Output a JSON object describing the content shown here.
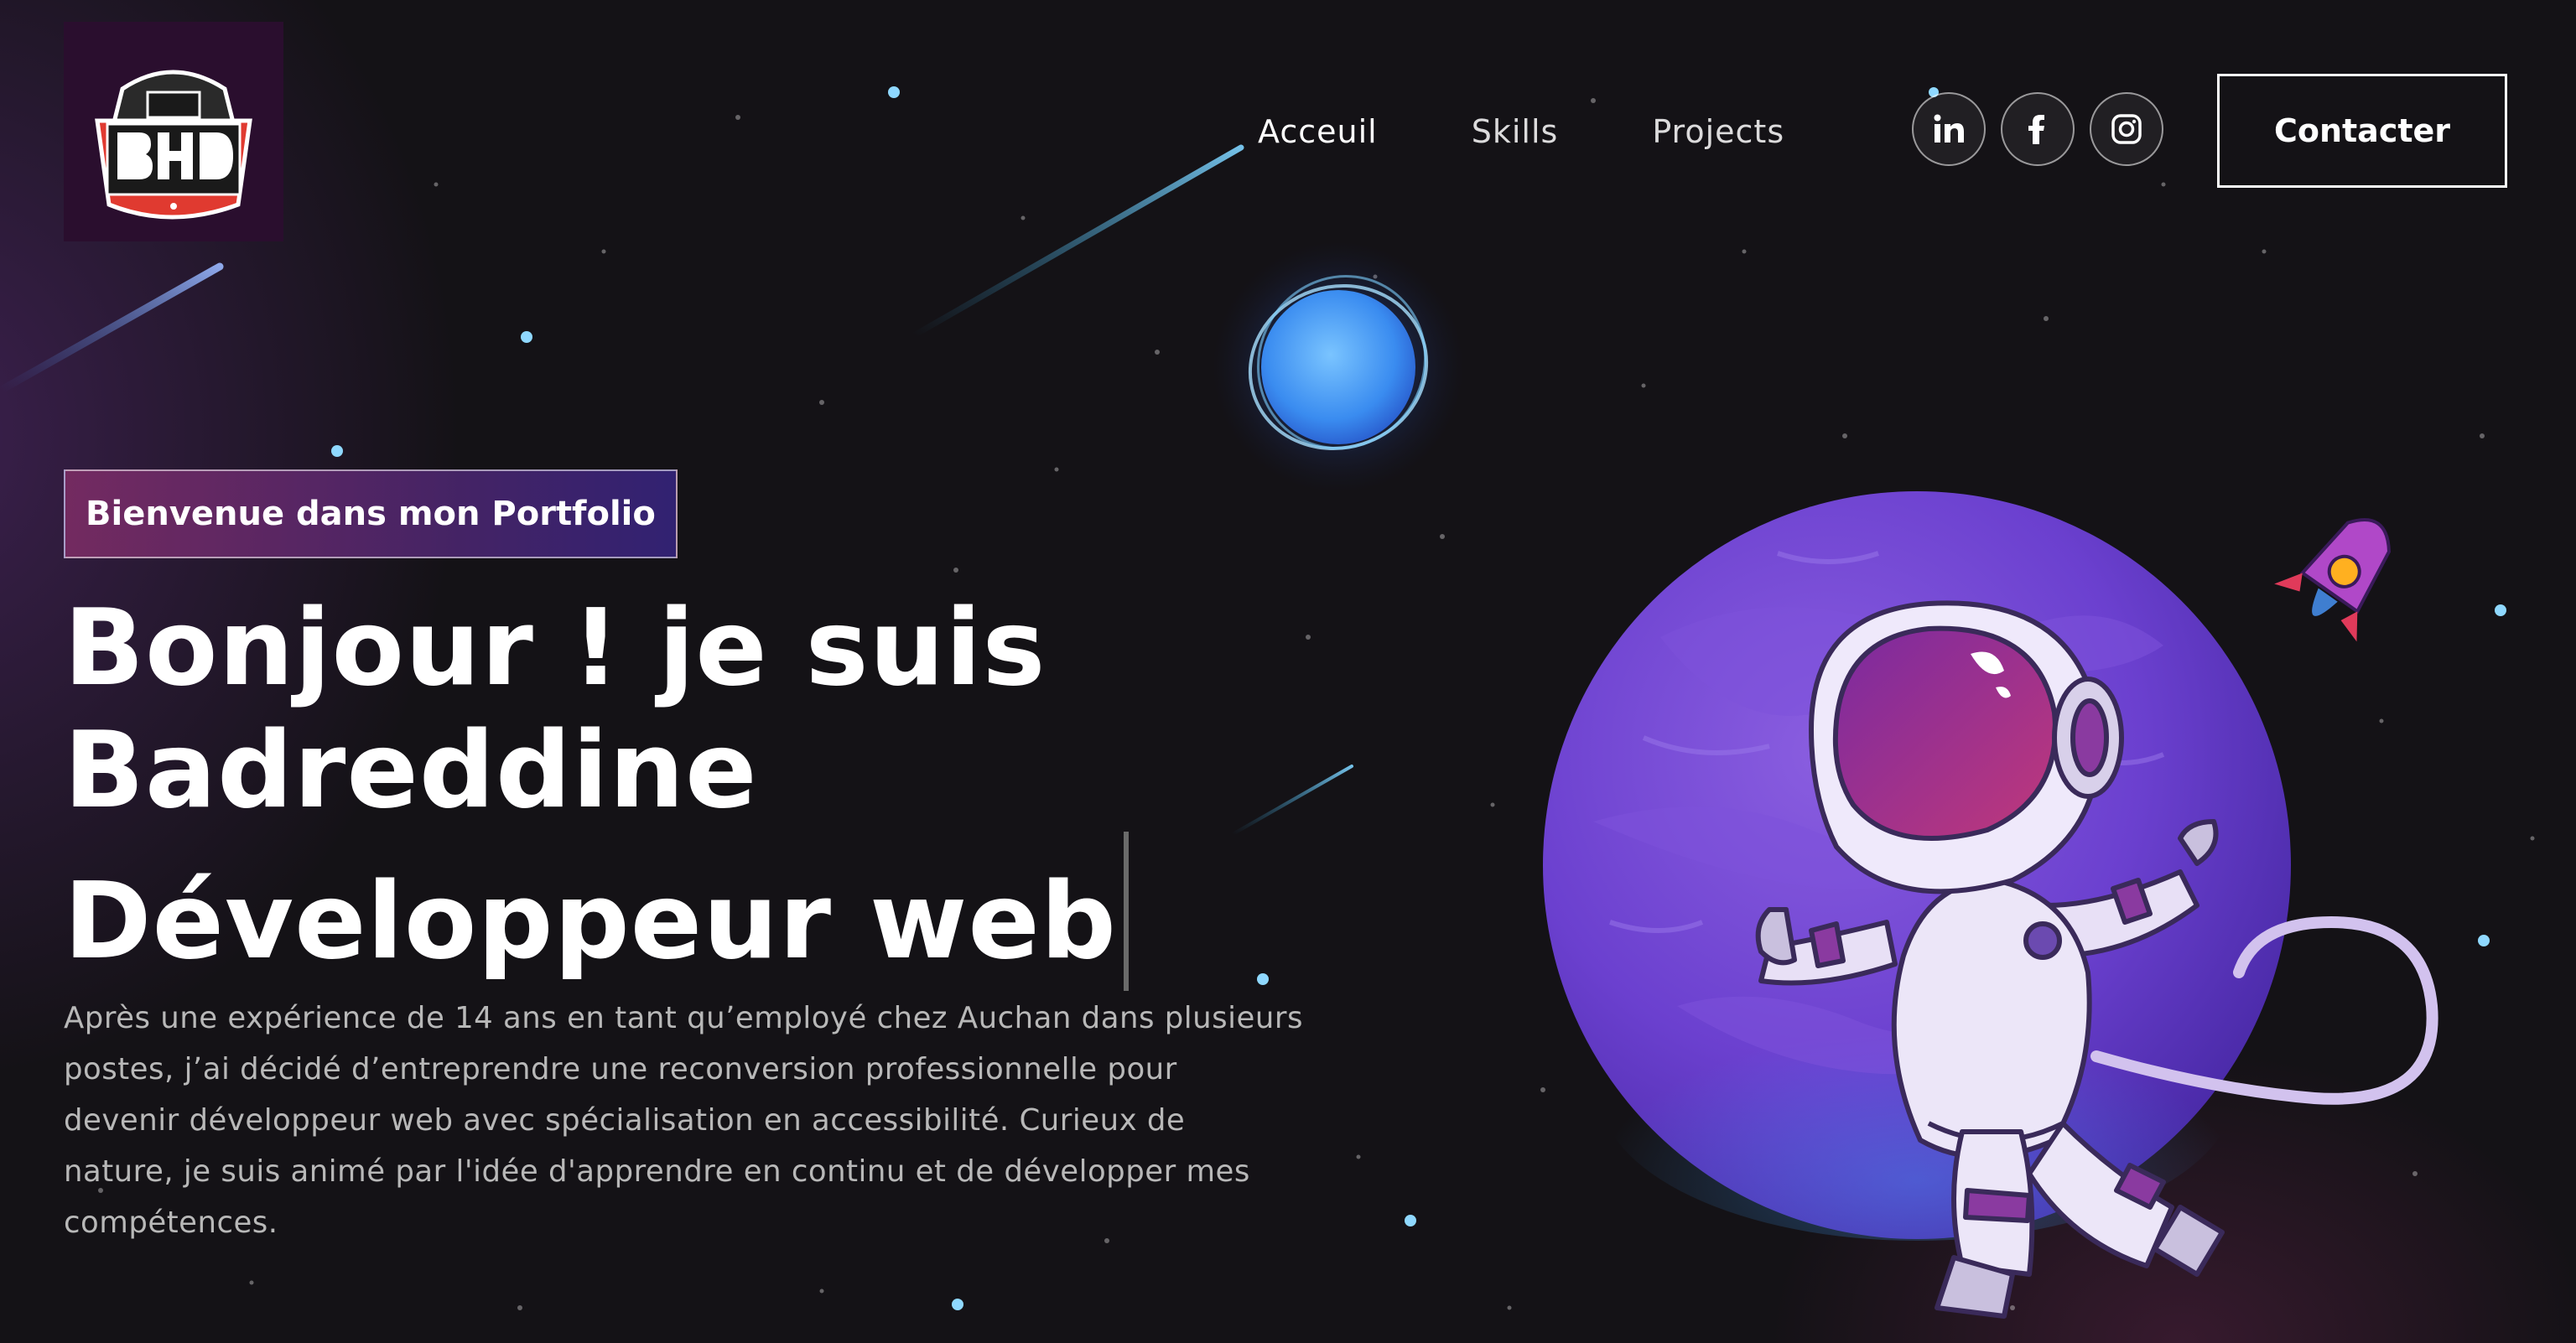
{
  "nav": {
    "logo_alt": "BHD",
    "links": [
      {
        "label": "Acceuil"
      },
      {
        "label": "Skills"
      },
      {
        "label": "Projects"
      }
    ],
    "social": [
      {
        "icon": "linkedin-icon"
      },
      {
        "icon": "facebook-icon"
      },
      {
        "icon": "instagram-icon"
      }
    ],
    "contact_label": "Contacter"
  },
  "hero": {
    "tagline": "Bienvenue dans mon Portfolio",
    "headline_lines": [
      "Bonjour ! je suis",
      "Badreddine",
      "Développeur web"
    ],
    "intro_lines": [
      "Après une expérience de 14 ans en tant qu’employé chez Auchan dans plusieurs",
      "postes, j’ai décidé d’entreprendre une reconversion professionnelle pour",
      "devenir développeur web avec spécialisation en accessibilité. Curieux de",
      "nature, je suis animé par l'idée d'apprendre en continu et de développer mes",
      "compétences."
    ]
  },
  "colors": {
    "background": "#141216",
    "accent_purple": "#6b3fd6",
    "accent_pink": "#aa367c",
    "text_muted": "#b8b8b8"
  }
}
